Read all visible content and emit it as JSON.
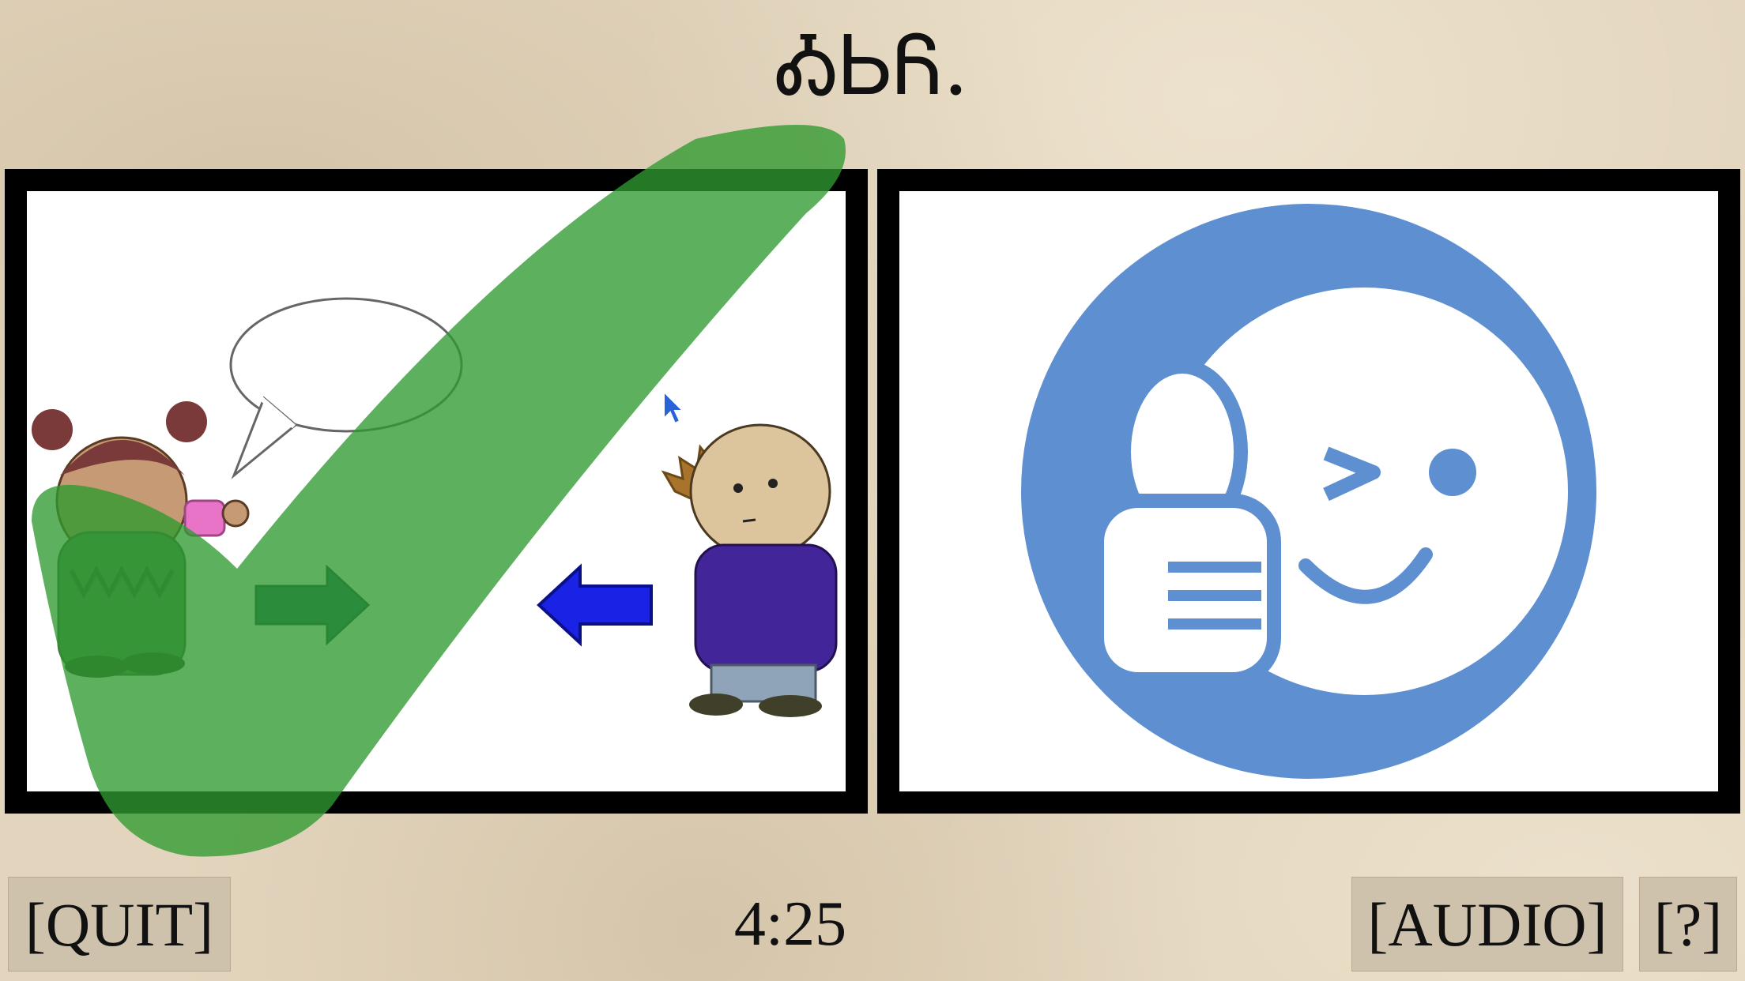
{
  "prompt": {
    "text": "ᎣᏏᏲ."
  },
  "choices": [
    {
      "id": "left",
      "description_icon": "give-to-boy-illustration",
      "state": "correct"
    },
    {
      "id": "right",
      "description_icon": "thumbs-up-wink-icon",
      "state": "unselected"
    }
  ],
  "feedback": {
    "icon": "checkmark-icon",
    "color": "#2f9a2f"
  },
  "controls": {
    "quit_label": "[QUIT]",
    "audio_label": "[AUDIO]",
    "help_label": "[?]"
  },
  "timer": {
    "value": "4:25"
  },
  "colors": {
    "background": "#e3d5bd",
    "frame": "#000000",
    "icon_blue": "#5e8fd0",
    "check_green": "#2f9a2f",
    "button_bg": "#cfc2ac"
  }
}
